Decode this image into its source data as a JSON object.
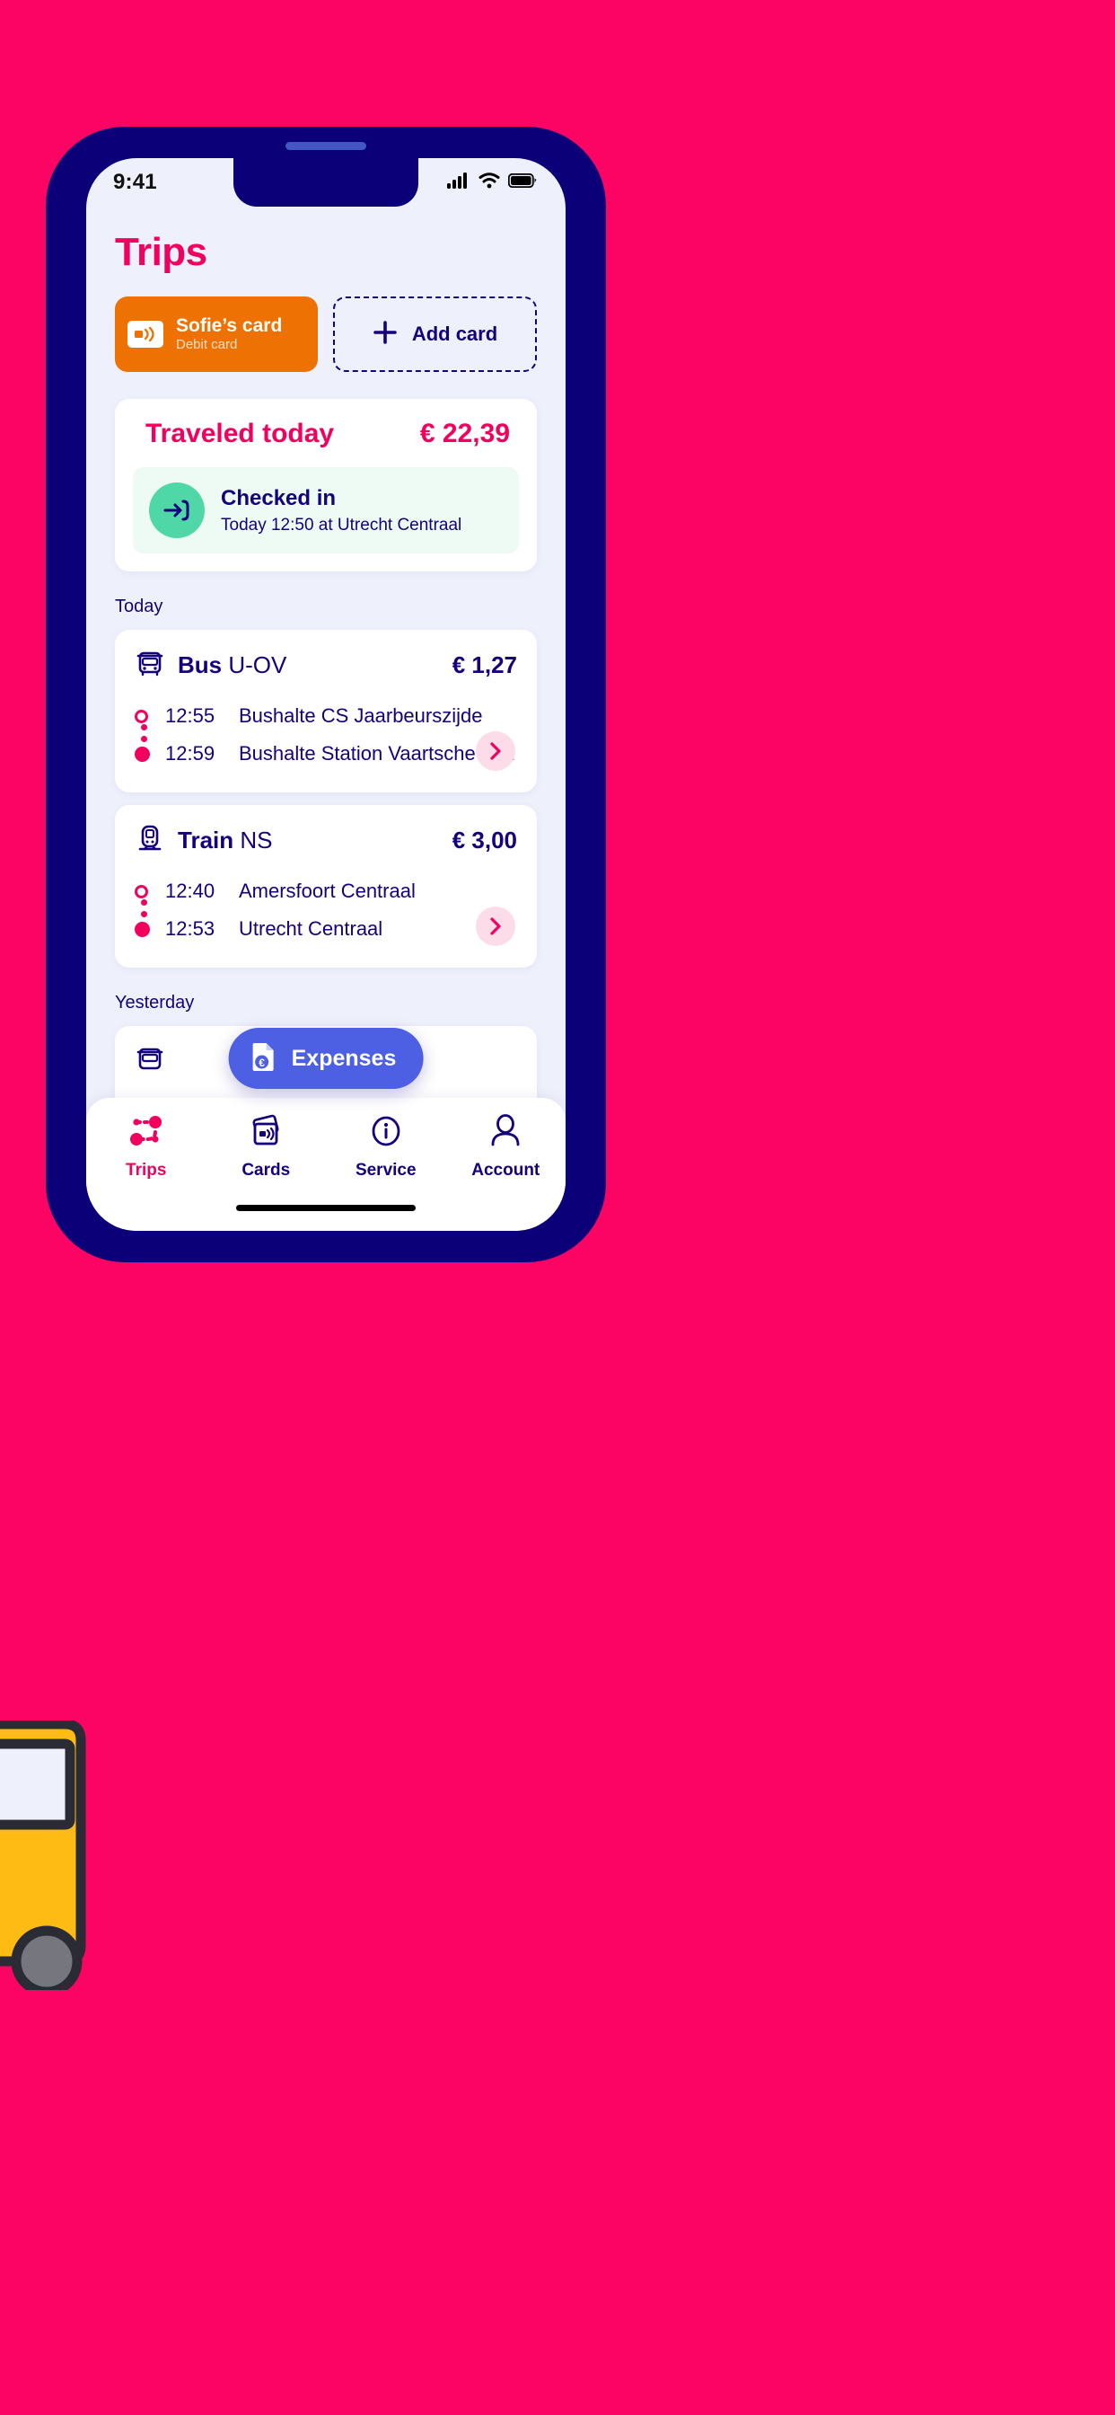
{
  "theme": {
    "background": "#FB0463",
    "phone_bezel": "#0B0077",
    "screen_bg": "#EEF0FB",
    "accent_pink": "#F1005E",
    "navy": "#14017D",
    "orange": "#EE7203",
    "green": "#4FD7A8",
    "blue": "#4D5FE3"
  },
  "status_bar": {
    "time": "9:41",
    "signal_icon": "cellular-signal-icon",
    "wifi_icon": "wifi-icon",
    "battery_icon": "battery-full-icon"
  },
  "header": {
    "title": "Trips"
  },
  "card_selector": {
    "active_card": {
      "icon": "contactless-card-icon",
      "title": "Sofie’s card",
      "subtitle": "Debit card"
    },
    "add_card": {
      "icon": "plus-icon",
      "label": "Add card"
    }
  },
  "traveled_today": {
    "title": "Traveled today",
    "amount": "€ 22,39",
    "status": {
      "icon": "check-in-arrow-icon",
      "title": "Checked in",
      "detail": "Today 12:50 at Utrecht Centraal"
    }
  },
  "sections": [
    {
      "label": "Today",
      "trips": [
        {
          "icon": "bus-icon",
          "mode": "Bus",
          "operator": "U-OV",
          "price": "€ 1,27",
          "stops": [
            {
              "time": "12:55",
              "name": "Bushalte CS Jaarbeurszijde"
            },
            {
              "time": "12:59",
              "name": "Bushalte Station Vaartsche Rijn"
            }
          ],
          "chevron_icon": "chevron-right-icon"
        },
        {
          "icon": "train-icon",
          "mode": "Train",
          "operator": "NS",
          "price": "€ 3,00",
          "stops": [
            {
              "time": "12:40",
              "name": "Amersfoort Centraal"
            },
            {
              "time": "12:53",
              "name": "Utrecht Centraal"
            }
          ],
          "chevron_icon": "chevron-right-icon"
        }
      ]
    },
    {
      "label": "Yesterday",
      "trips": [
        {
          "icon": "bus-icon",
          "mode": "",
          "operator": "",
          "price": "",
          "stops": [],
          "chevron_icon": "chevron-right-icon"
        }
      ]
    }
  ],
  "expenses_fab": {
    "icon": "document-euro-icon",
    "label": "Expenses"
  },
  "bottom_nav": {
    "items": [
      {
        "icon": "route-trips-icon",
        "label": "Trips",
        "active": true
      },
      {
        "icon": "cards-nfc-icon",
        "label": "Cards",
        "active": false
      },
      {
        "icon": "info-circle-icon",
        "label": "Service",
        "active": false
      },
      {
        "icon": "person-icon",
        "label": "Account",
        "active": false
      }
    ]
  }
}
